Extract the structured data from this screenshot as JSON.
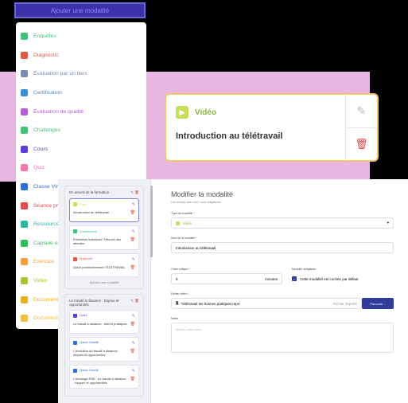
{
  "top_button": {
    "label": "Ajouter une modalité"
  },
  "menu": {
    "items": [
      {
        "label": "Enquêtes",
        "color": "#3ebf7a"
      },
      {
        "label": "Diagnostic",
        "color": "#e0584a"
      },
      {
        "label": "Évaluation par un tiers",
        "color": "#7b8ab0"
      },
      {
        "label": "Certification",
        "color": "#3c8fd6"
      },
      {
        "label": "Évaluation de qualité",
        "color": "#b45fd6"
      },
      {
        "label": "Challenges",
        "color": "#45c07a"
      },
      {
        "label": "Cours",
        "color": "#5a3fd6"
      },
      {
        "label": "Quiz",
        "color": "#f07ab0"
      },
      {
        "label": "Classe Virtuelle",
        "color": "#2f6fd6"
      },
      {
        "label": "Séance présentielle",
        "color": "#e04a4a"
      },
      {
        "label": "Ressource externe",
        "color": "#2fb6a0"
      },
      {
        "label": "Capsule e-learning",
        "color": "#2fc05a"
      },
      {
        "label": "Exercice",
        "color": "#f0a040"
      },
      {
        "label": "Vidéo",
        "color": "#a6c238"
      },
      {
        "label": "Document à télécharger",
        "color": "#e8b020"
      },
      {
        "label": "Document à lire",
        "color": "#f0c040"
      }
    ]
  },
  "video_card": {
    "tag": "Vidéo",
    "title": "Introduction au télétravail"
  },
  "left_column": {
    "section1": {
      "title": "En amont de la formation",
      "items": [
        {
          "type": "Vidéo",
          "color": "#c8de5a",
          "text": "Introduction au télétravail"
        },
        {
          "type": "Questionnaire",
          "color": "#3ebf7a",
          "text": "Entretiens individuel / Recueil des attentes"
        },
        {
          "type": "Diagnostic",
          "color": "#e0584a",
          "text": "Quizz positionnement TÉLÉTRAVAIL"
        }
      ],
      "add_label": "Ajouter une modalité"
    },
    "section2": {
      "title": "Le travail à distance : Enjeux et opportunités",
      "items": [
        {
          "type": "Cours",
          "color": "#5a3fd6",
          "text": "Le travail à distance : état et pratiques"
        },
        {
          "type": "Classe Virtuelle",
          "color": "#2f6fd6",
          "text": "L'évolution du travail à distance : risques et opportunités"
        },
        {
          "type": "Classe Virtuelle",
          "color": "#2f6fd6",
          "text": "L'échange RSE : Le travail à distance : risques et opportunités"
        }
      ]
    }
  },
  "form": {
    "title": "Modifier la modalité",
    "subtitle": "Les champs avec une * sont obligatoires",
    "type_label": "Type de modalité *",
    "type_value": "Vidéo",
    "name_label": "Nom de la modalité *",
    "name_value": "Introduction au télétravail",
    "order_label": "Ordre critique *",
    "order_value": "5",
    "order_unit": "minutes",
    "mandatory_label": "Modalité obligatoire",
    "mandatory_text": "Cette modalité est cochée par défaut",
    "file_label": "Fichier vidéo *",
    "file_value": "Télétravail les bonnes pratiques.mp4",
    "file_note": "Fichier importé",
    "browse_label": "Parcourir...",
    "notes_label": "Notes",
    "notes_placeholder": "Ajouter votre texte"
  }
}
